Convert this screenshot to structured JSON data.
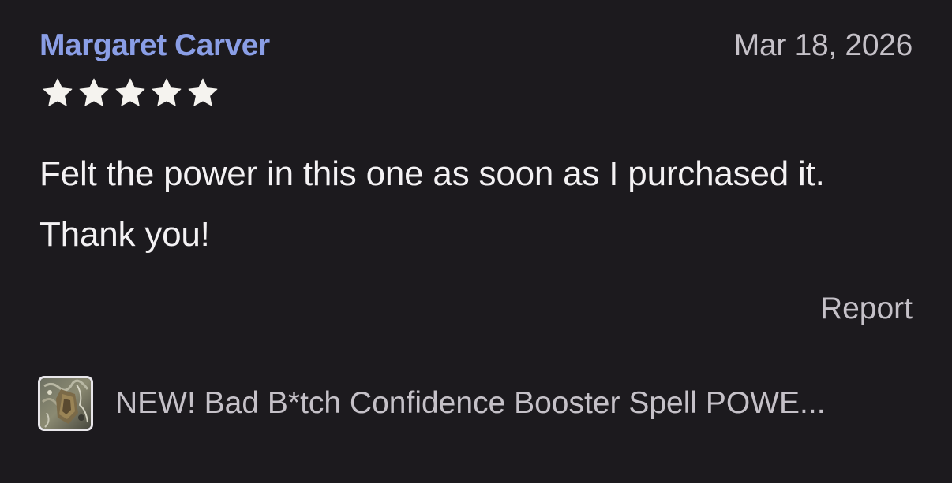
{
  "review": {
    "reviewer_name": "Margaret Carver",
    "date": "Mar 18, 2026",
    "rating": 5,
    "rating_max": 5,
    "text": "Felt the power in this one as soon as I purchased it. Thank you!",
    "report_label": "Report"
  },
  "listing": {
    "title": "NEW! Bad B*tch Confidence Booster Spell POWE...",
    "thumbnail_icon": "listing-thumbnail-image"
  },
  "colors": {
    "background": "#1c1a1e",
    "reviewer_name": "#8a9ee6",
    "star": "#f5f3ef",
    "secondary_text": "#c5c1c8",
    "primary_text": "#f4f2f4"
  }
}
